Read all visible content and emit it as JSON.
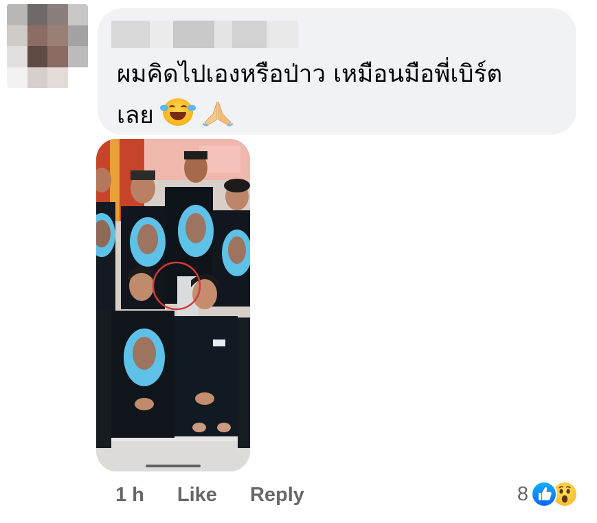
{
  "comment": {
    "author_name": "",
    "text_line1": "ผมคิดไปเองหรือป่าว เหมือนมือพี่เบิร์ต",
    "text_line2": "เลย",
    "emojis": [
      "face-with-tears-of-joy-icon",
      "folded-hands-icon"
    ]
  },
  "actions": {
    "time": "1 h",
    "like_label": "Like",
    "reply_label": "Reply"
  },
  "reactions": {
    "count": "8",
    "types": [
      "like-icon",
      "wow-icon"
    ]
  },
  "colors": {
    "bubble_bg": "#f0f2f5",
    "meta_text": "#65676b",
    "like_blue": "#0866ff",
    "annotation_circle": "#d63a35"
  }
}
